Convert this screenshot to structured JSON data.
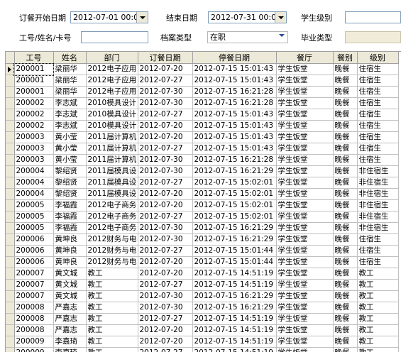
{
  "filters": {
    "order_start_label": "订餐开始日期",
    "order_start_value": "2012-07-01 00:00",
    "end_date_label": "结束日期",
    "end_date_value": "2012-07-31 00:00",
    "student_level_label": "学生级别",
    "id_label": "工号/姓名/卡号",
    "id_value": "",
    "archive_type_label": "档案类型",
    "archive_type_value": "在职",
    "grad_type_label": "毕业类型"
  },
  "table": {
    "columns": [
      "工号",
      "姓名",
      "部门",
      "订餐日期",
      "停餐日期",
      "餐厅",
      "餐别",
      "级别"
    ],
    "rows": [
      [
        "200001",
        "梁丽华",
        "2012电子应用",
        "2012-07-20",
        "2012-07-15 15:01:43",
        "学生饭堂",
        "晚餐",
        "住宿生"
      ],
      [
        "200001",
        "梁丽华",
        "2012电子应用",
        "2012-07-27",
        "2012-07-15 15:01:43",
        "学生饭堂",
        "晚餐",
        "住宿生"
      ],
      [
        "200001",
        "梁丽华",
        "2012电子应用",
        "2012-07-30",
        "2012-07-15 16:21:28",
        "学生饭堂",
        "晚餐",
        "住宿生"
      ],
      [
        "200002",
        "李志斌",
        "2010模具设计",
        "2012-07-30",
        "2012-07-15 16:21:28",
        "学生饭堂",
        "晚餐",
        "住宿生"
      ],
      [
        "200002",
        "李志斌",
        "2010模具设计",
        "2012-07-27",
        "2012-07-15 15:01:43",
        "学生饭堂",
        "晚餐",
        "住宿生"
      ],
      [
        "200002",
        "李志斌",
        "2010模具设计",
        "2012-07-20",
        "2012-07-15 15:01:43",
        "学生饭堂",
        "晚餐",
        "住宿生"
      ],
      [
        "200003",
        "黄小莹",
        "2011届计算机",
        "2012-07-20",
        "2012-07-15 15:01:43",
        "学生饭堂",
        "晚餐",
        "住宿生"
      ],
      [
        "200003",
        "黄小莹",
        "2011届计算机",
        "2012-07-27",
        "2012-07-15 15:01:43",
        "学生饭堂",
        "晚餐",
        "住宿生"
      ],
      [
        "200003",
        "黄小莹",
        "2011届计算机",
        "2012-07-30",
        "2012-07-15 16:21:28",
        "学生饭堂",
        "晚餐",
        "住宿生"
      ],
      [
        "200004",
        "黎绍贤",
        "2011届模具设",
        "2012-07-30",
        "2012-07-15 16:21:29",
        "学生饭堂",
        "晚餐",
        "非住宿生"
      ],
      [
        "200004",
        "黎绍贤",
        "2011届模具设",
        "2012-07-27",
        "2012-07-15 15:02:01",
        "学生饭堂",
        "晚餐",
        "非住宿生"
      ],
      [
        "200004",
        "黎绍贤",
        "2011届模具设",
        "2012-07-20",
        "2012-07-15 15:02:01",
        "学生饭堂",
        "晚餐",
        "非住宿生"
      ],
      [
        "200005",
        "李福霞",
        "2012电子商务",
        "2012-07-20",
        "2012-07-15 15:02:01",
        "学生饭堂",
        "晚餐",
        "非住宿生"
      ],
      [
        "200005",
        "李福霞",
        "2012电子商务",
        "2012-07-27",
        "2012-07-15 15:02:01",
        "学生饭堂",
        "晚餐",
        "非住宿生"
      ],
      [
        "200005",
        "李福霞",
        "2012电子商务",
        "2012-07-30",
        "2012-07-15 16:21:29",
        "学生饭堂",
        "晚餐",
        "非住宿生"
      ],
      [
        "200006",
        "黄坤良",
        "2012财务与电",
        "2012-07-30",
        "2012-07-15 16:21:29",
        "学生饭堂",
        "晚餐",
        "住宿生"
      ],
      [
        "200006",
        "黄坤良",
        "2012财务与电",
        "2012-07-27",
        "2012-07-15 15:01:44",
        "学生饭堂",
        "晚餐",
        "住宿生"
      ],
      [
        "200006",
        "黄坤良",
        "2012财务与电",
        "2012-07-20",
        "2012-07-15 15:01:44",
        "学生饭堂",
        "晚餐",
        "住宿生"
      ],
      [
        "200007",
        "黄文城",
        "教工",
        "2012-07-20",
        "2012-07-15 14:51:19",
        "学生饭堂",
        "晚餐",
        "教工"
      ],
      [
        "200007",
        "黄文城",
        "教工",
        "2012-07-27",
        "2012-07-15 14:51:19",
        "学生饭堂",
        "晚餐",
        "教工"
      ],
      [
        "200007",
        "黄文城",
        "教工",
        "2012-07-30",
        "2012-07-15 16:21:29",
        "学生饭堂",
        "晚餐",
        "教工"
      ],
      [
        "200008",
        "严嘉志",
        "教工",
        "2012-07-30",
        "2012-07-15 16:21:29",
        "学生饭堂",
        "晚餐",
        "教工"
      ],
      [
        "200008",
        "严嘉志",
        "教工",
        "2012-07-27",
        "2012-07-15 14:51:19",
        "学生饭堂",
        "晚餐",
        "教工"
      ],
      [
        "200008",
        "严嘉志",
        "教工",
        "2012-07-20",
        "2012-07-15 14:51:19",
        "学生饭堂",
        "晚餐",
        "教工"
      ],
      [
        "200009",
        "李嘉琦",
        "教工",
        "2012-07-20",
        "2012-07-15 14:51:19",
        "学生饭堂",
        "晚餐",
        "教工"
      ],
      [
        "200009",
        "李嘉琦",
        "教工",
        "2012-07-27",
        "2012-07-15 14:51:19",
        "学生饭堂",
        "晚餐",
        "教工"
      ]
    ]
  }
}
